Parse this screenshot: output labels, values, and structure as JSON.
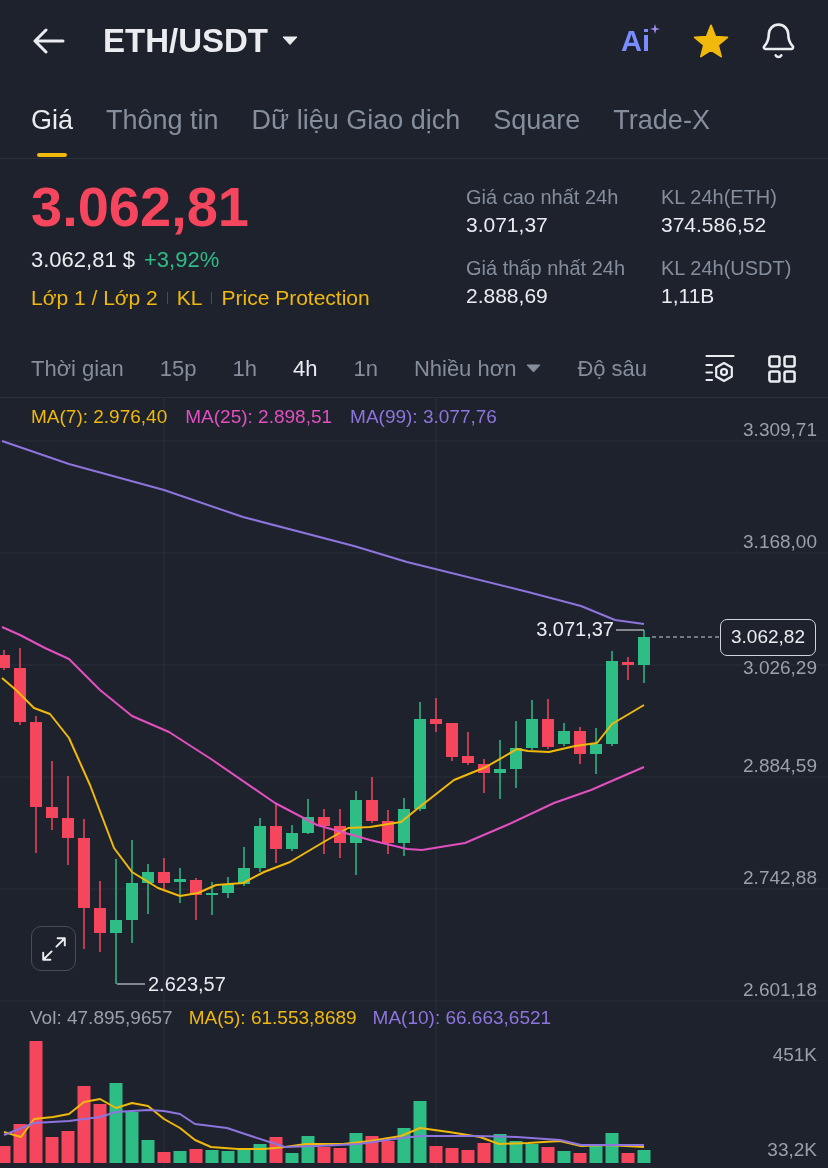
{
  "header": {
    "pair": "ETH/USDT",
    "ai_label": "Ai",
    "favorite": true
  },
  "tabs": [
    {
      "label": "Giá",
      "selected": true
    },
    {
      "label": "Thông tin",
      "selected": false
    },
    {
      "label": "Dữ liệu Giao dịch",
      "selected": false
    },
    {
      "label": "Square",
      "selected": false
    },
    {
      "label": "Trade-X",
      "selected": false
    }
  ],
  "price": {
    "last": "3.062,81",
    "last_rising": false,
    "fiat": "3.062,81 $",
    "change": "+3,92%",
    "change_rising": true,
    "tags": [
      "Lớp 1 / Lớp 2",
      "KL",
      "Price Protection"
    ]
  },
  "stats": [
    {
      "label": "Giá cao nhất 24h",
      "value": "3.071,37"
    },
    {
      "label": "KL 24h(ETH)",
      "value": "374.586,52"
    },
    {
      "label": "Giá thấp nhất 24h",
      "value": "2.888,69"
    },
    {
      "label": "KL 24h(USDT)",
      "value": "1,11B"
    }
  ],
  "chart_toolbar": [
    {
      "kind": "tab",
      "label": "Thời gian",
      "selected": false
    },
    {
      "kind": "tab",
      "label": "15p",
      "selected": false
    },
    {
      "kind": "tab",
      "label": "1h",
      "selected": false
    },
    {
      "kind": "tab",
      "label": "4h",
      "selected": true
    },
    {
      "kind": "tab",
      "label": "1n",
      "selected": false
    },
    {
      "kind": "dropdown",
      "label": "Nhiều hơn",
      "selected": false
    },
    {
      "kind": "tab",
      "label": "Độ sâu",
      "selected": false
    }
  ],
  "price_chart": {
    "legend": [
      {
        "label": "MA(7): 2.976,40",
        "color": "#f0b90b"
      },
      {
        "label": "MA(25): 2.898,51",
        "color": "#e24fc0"
      },
      {
        "label": "MA(99): 3.077,76",
        "color": "#8e74dd"
      }
    ],
    "y_axis": [
      "3.309,71",
      "3.168,00",
      "3.026,29",
      "2.884,59",
      "2.742,88",
      "2.601,18"
    ],
    "high_label": "3.071,37",
    "low_label": "2.623,57",
    "last_price": "3.062,82"
  },
  "volume_chart": {
    "legend": [
      {
        "label": "Vol: 47.895,9657",
        "color": "#9aa0aa"
      },
      {
        "label": "MA(5): 61.553,8689",
        "color": "#f0b90b"
      },
      {
        "label": "MA(10): 66.663,6521",
        "color": "#8e74dd"
      }
    ],
    "y_axis": [
      "451K",
      "33,2K"
    ]
  }
}
